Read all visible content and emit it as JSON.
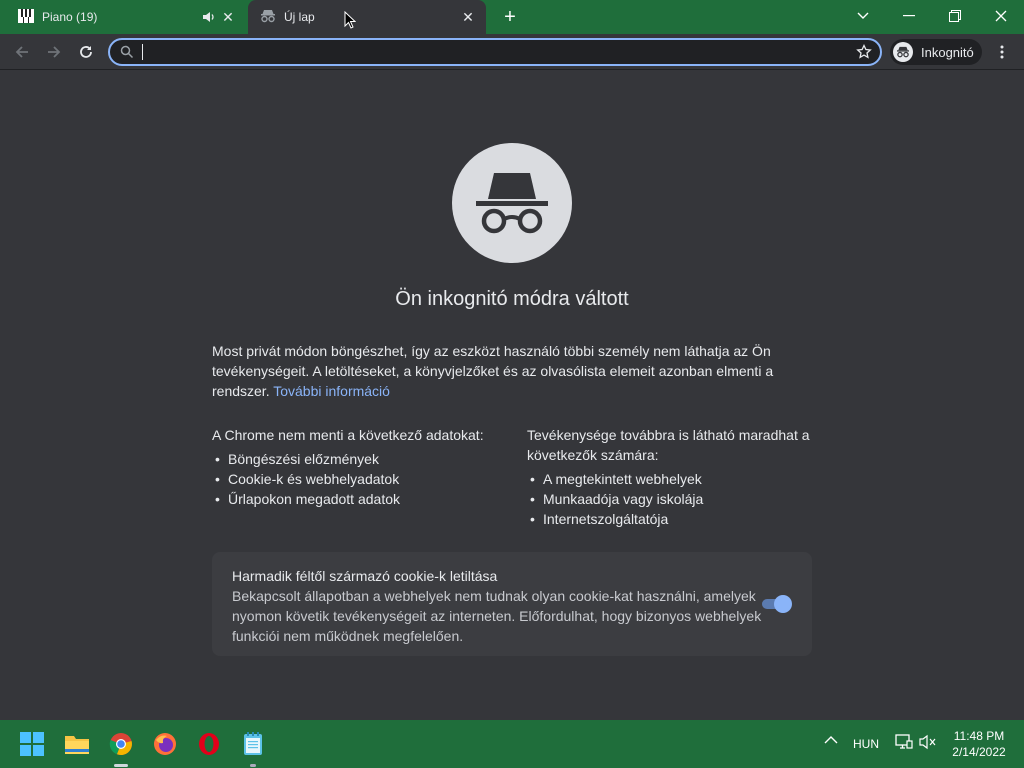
{
  "tabs": [
    {
      "title": "Piano (19)",
      "close": "✕"
    },
    {
      "title": "Új lap",
      "close": "✕"
    }
  ],
  "new_tab": "+",
  "omnibox": {
    "value": "",
    "placeholder": ""
  },
  "incognito_chip": "Inkognitó",
  "content": {
    "headline": "Ön inkognitó módra váltott",
    "intro": "Most privát módon böngészhet, így az eszközt használó többi személy nem láthatja az Ön tevékenységeit. A letöltéseket, a könyvjelzőket és az olvasólista elemeit azonban elmenti a rendszer.",
    "learn_more": "További információ",
    "col1_title": "A Chrome nem menti a következő adatokat:",
    "col1_items": [
      "Böngészési előzmények",
      "Cookie-k és webhelyadatok",
      "Űrlapokon megadott adatok"
    ],
    "col2_title": "Tevékenysége továbbra is látható maradhat a következők számára:",
    "col2_items": [
      "A megtekintett webhelyek",
      "Munkaadója vagy iskolája",
      "Internetszolgáltatója"
    ],
    "cookie_title": "Harmadik féltől származó cookie-k letiltása",
    "cookie_desc": "Bekapcsolt állapotban a webhelyek nem tudnak olyan cookie-kat használni, amelyek nyomon követik tevékenységeit az interneten. Előfordulhat, hogy bizonyos webhelyek funkciói nem működnek megfelelően.",
    "cookie_toggle_on": true
  },
  "taskbar": {
    "language": "HUN",
    "time": "11:48 PM",
    "date": "2/14/2022"
  },
  "colors": {
    "frame": "#1f6e3b",
    "background": "#35363a",
    "accent": "#8ab4f8"
  }
}
